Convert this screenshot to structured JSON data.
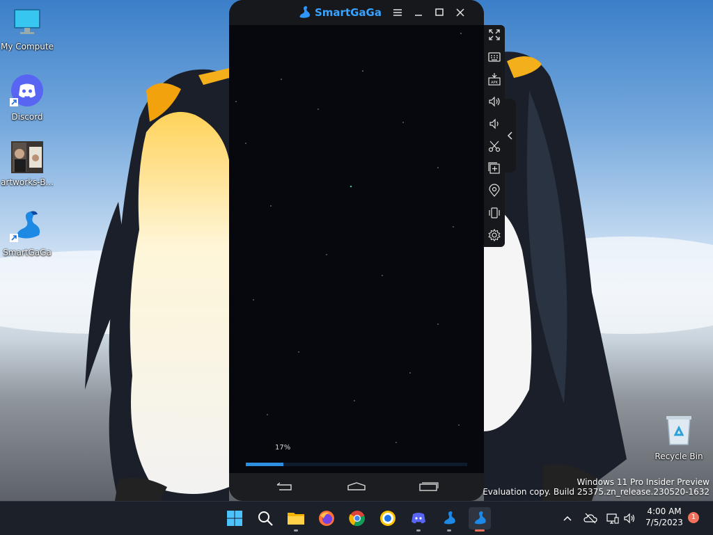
{
  "desktop": {
    "icons": [
      {
        "label": "My Computer",
        "icon": "monitor-icon"
      },
      {
        "label": "Discord",
        "icon": "discord-icon"
      },
      {
        "label": "artworks-B...",
        "icon": "image-thumbnail-icon"
      },
      {
        "label": "SmartGaGa",
        "icon": "smartgaga-swan-icon"
      },
      {
        "label": "Recycle Bin",
        "icon": "recycle-bin-icon"
      }
    ],
    "watermark": {
      "line1": "Windows 11 Pro Insider Preview",
      "line2": "Evaluation copy. Build 25375.zn_release.230520-1632"
    }
  },
  "emulator": {
    "title": "SmartGaGa",
    "loading": {
      "percent_label": "17%",
      "progress": 0.17
    },
    "window_buttons": [
      "menu-icon",
      "minimize-icon",
      "maximize-icon",
      "close-icon"
    ],
    "nav_buttons": [
      "back-icon",
      "home-icon",
      "recents-icon"
    ],
    "toolbar": [
      "fullscreen-icon",
      "keyboard-icon",
      "install-apk-icon",
      "volume-up-icon",
      "volume-down-icon",
      "screenshot-scissors-icon",
      "multi-instance-icon",
      "location-icon",
      "shake-icon",
      "settings-gear-icon"
    ]
  },
  "taskbar": {
    "apps": [
      "start-windows-icon",
      "search-icon",
      "file-explorer-icon",
      "firefox-icon",
      "chrome-icon",
      "browser-icon",
      "discord-icon",
      "smartgaga-icon",
      "smartgaga-active-icon"
    ],
    "clock": {
      "time": "4:00 AM",
      "date": "7/5/2023"
    },
    "notification_count": "1"
  },
  "colors": {
    "accent": "#3aa3ff",
    "taskbar": "#1c2028",
    "emulator_bg": "#06080d"
  }
}
